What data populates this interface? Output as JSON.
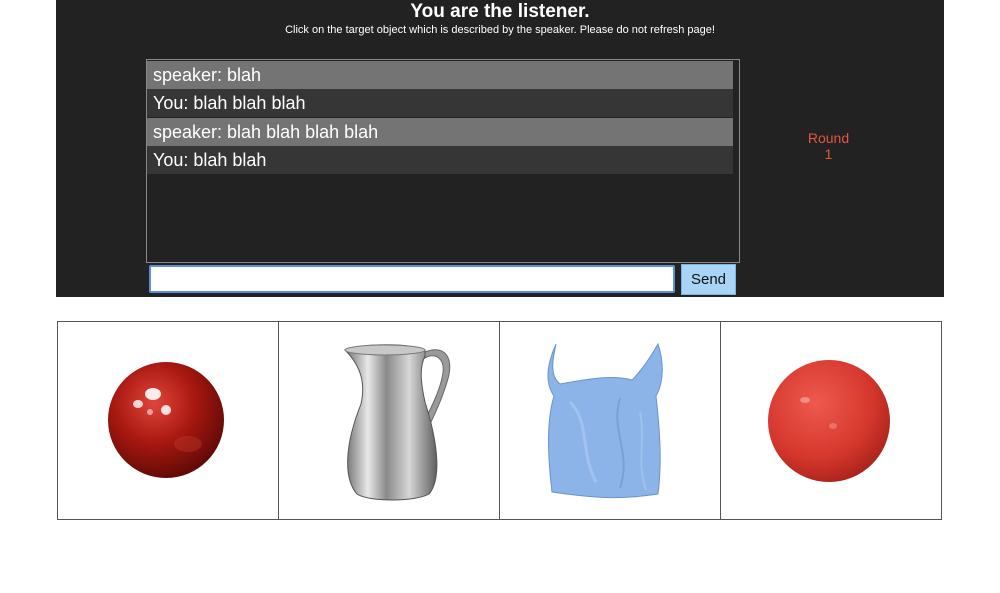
{
  "header": {
    "title": "You are the listener.",
    "subtitle": "Click on the target object which is described by the speaker. Please do not refresh page!"
  },
  "chat": {
    "messages": [
      {
        "role": "speaker",
        "text": "speaker: blah"
      },
      {
        "role": "you",
        "text": "You: blah blah blah"
      },
      {
        "role": "speaker",
        "text": "speaker: blah blah blah blah"
      },
      {
        "role": "you",
        "text": "You: blah blah"
      }
    ],
    "input_value": "",
    "send_label": "Send"
  },
  "round": {
    "label": "Round",
    "number": "1"
  },
  "objects": [
    {
      "name": "shiny-red-sphere",
      "color": "#b01a12"
    },
    {
      "name": "silver-pitcher",
      "color": "#a9a9a9"
    },
    {
      "name": "blue-plastic-bag",
      "color": "#8cb4e8"
    },
    {
      "name": "matte-red-sphere",
      "color": "#d8382e"
    }
  ],
  "colors": {
    "panel": "#222222",
    "speaker_row": "#747474",
    "you_row": "#363636",
    "round_text": "#e4553d",
    "send_button": "#a8d4f5"
  }
}
